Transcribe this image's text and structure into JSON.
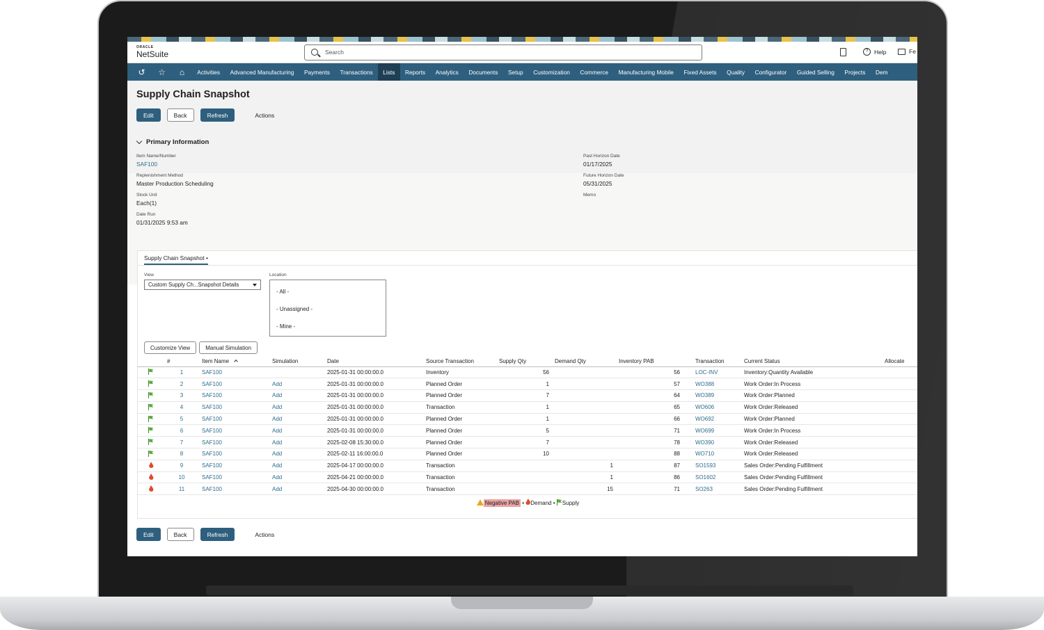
{
  "app": {
    "logo_top": "ORACLE",
    "logo_bottom": "NetSuite",
    "search_placeholder": "Search",
    "help_label": "Help",
    "feedback_label": "Fe"
  },
  "nav": {
    "items": [
      "Activities",
      "Advanced Manufacturing",
      "Payments",
      "Transactions",
      "Lists",
      "Reports",
      "Analytics",
      "Documents",
      "Setup",
      "Customization",
      "Commerce",
      "Manufacturing Mobile",
      "Fixed Assets",
      "Quality",
      "Configurator",
      "Guided Selling",
      "Projects",
      "Dem"
    ],
    "active": "Lists"
  },
  "page": {
    "title": "Supply Chain Snapshot",
    "buttons": {
      "edit": "Edit",
      "back": "Back",
      "refresh": "Refresh",
      "actions": "Actions"
    }
  },
  "primary_info": {
    "section_title": "Primary Information",
    "item_name_label": "Item Name/Number",
    "item_name_value": "SAF100",
    "replenishment_label": "Replenishment Method",
    "replenishment_value": "Master Production Scheduling",
    "stock_unit_label": "Stock Unit",
    "stock_unit_value": "Each(1)",
    "date_run_label": "Date Run",
    "date_run_value": "01/31/2025 9:53 am",
    "past_horizon_label": "Past Horizon Date",
    "past_horizon_value": "01/17/2025",
    "future_horizon_label": "Future Horizon Date",
    "future_horizon_value": "05/31/2025",
    "memo_label": "Memo"
  },
  "subtab": {
    "label": "Supply Chain Snapshot •",
    "view_label": "View",
    "view_value": "Custom Supply Ch...Snapshot Details",
    "location_label": "Location",
    "location_options": [
      "- All -",
      "- Unassigned -",
      "- Mine -"
    ],
    "customize_view": "Customize View",
    "manual_simulation": "Manual Simulation"
  },
  "table": {
    "headers": {
      "num": "#",
      "item": "Item Name",
      "simulation": "Simulation",
      "date": "Date",
      "source": "Source Transaction",
      "supply": "Supply Qty",
      "demand": "Demand Qty",
      "pab": "Inventory PAB",
      "transaction": "Transaction",
      "status": "Current Status",
      "allocated": "Allocate"
    },
    "rows": [
      {
        "type": "supply",
        "num": "1",
        "item": "SAF100",
        "sim": "",
        "date": "2025-01-31 00:00:00.0",
        "source": "Inventory",
        "supply": "56",
        "demand": "",
        "pab": "56",
        "txn": "LOC-INV",
        "status": "Inventory:Quantity Available"
      },
      {
        "type": "supply",
        "num": "2",
        "item": "SAF100",
        "sim": "Add",
        "date": "2025-01-31 00:00:00.0",
        "source": "Planned Order",
        "supply": "1",
        "demand": "",
        "pab": "57",
        "txn": "WO388",
        "status": "Work Order:In Process"
      },
      {
        "type": "supply",
        "num": "3",
        "item": "SAF100",
        "sim": "Add",
        "date": "2025-01-31 00:00:00.0",
        "source": "Planned Order",
        "supply": "7",
        "demand": "",
        "pab": "64",
        "txn": "WO389",
        "status": "Work Order:Planned"
      },
      {
        "type": "supply",
        "num": "4",
        "item": "SAF100",
        "sim": "Add",
        "date": "2025-01-31 00:00:00.0",
        "source": "Transaction",
        "supply": "1",
        "demand": "",
        "pab": "65",
        "txn": "WO606",
        "status": "Work Order:Released"
      },
      {
        "type": "supply",
        "num": "5",
        "item": "SAF100",
        "sim": "Add",
        "date": "2025-01-31 00:00:00.0",
        "source": "Planned Order",
        "supply": "1",
        "demand": "",
        "pab": "66",
        "txn": "WO692",
        "status": "Work Order:Planned"
      },
      {
        "type": "supply",
        "num": "6",
        "item": "SAF100",
        "sim": "Add",
        "date": "2025-01-31 00:00:00.0",
        "source": "Planned Order",
        "supply": "5",
        "demand": "",
        "pab": "71",
        "txn": "WO699",
        "status": "Work Order:In Process"
      },
      {
        "type": "supply",
        "num": "7",
        "item": "SAF100",
        "sim": "Add",
        "date": "2025-02-08 15:30:00.0",
        "source": "Planned Order",
        "supply": "7",
        "demand": "",
        "pab": "78",
        "txn": "WO390",
        "status": "Work Order:Released"
      },
      {
        "type": "supply",
        "num": "8",
        "item": "SAF100",
        "sim": "Add",
        "date": "2025-02-11 16:00:00.0",
        "source": "Planned Order",
        "supply": "10",
        "demand": "",
        "pab": "88",
        "txn": "WO710",
        "status": "Work Order:Released"
      },
      {
        "type": "demand",
        "num": "9",
        "item": "SAF100",
        "sim": "Add",
        "date": "2025-04-17 00:00:00.0",
        "source": "Transaction",
        "supply": "",
        "demand": "1",
        "pab": "87",
        "txn": "SO1593",
        "status": "Sales Order:Pending Fulfillment"
      },
      {
        "type": "demand",
        "num": "10",
        "item": "SAF100",
        "sim": "Add",
        "date": "2025-04-21 00:00:00.0",
        "source": "Transaction",
        "supply": "",
        "demand": "1",
        "pab": "86",
        "txn": "SO1602",
        "status": "Sales Order:Pending Fulfillment"
      },
      {
        "type": "demand",
        "num": "11",
        "item": "SAF100",
        "sim": "Add",
        "date": "2025-04-30 00:00:00.0",
        "source": "Transaction",
        "supply": "",
        "demand": "15",
        "pab": "71",
        "txn": "SO263",
        "status": "Sales Order:Pending Fulfillment"
      }
    ]
  },
  "legend": {
    "negative": "Negative PAB",
    "sep1": "•",
    "demand": "Demand",
    "sep2": "•",
    "supply": "Supply"
  },
  "colors": {
    "nav_bg": "#2f5f7e",
    "link": "#2d6c8e",
    "supply_flag": "#5aa83a",
    "demand_fire": "#e04a2a"
  }
}
